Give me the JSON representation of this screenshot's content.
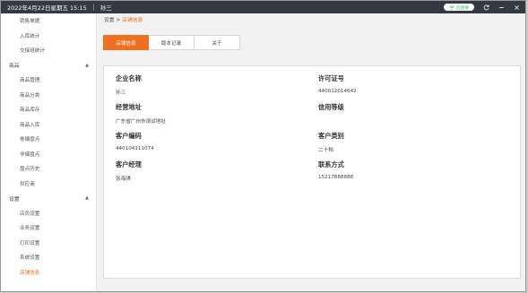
{
  "titlebar": {
    "datetime": "2022年4月22日星期五 15:15",
    "user": "孙三",
    "network_label": "已连接"
  },
  "sidebar": {
    "top_items": [
      {
        "label": "销售单据"
      },
      {
        "label": "入库统计"
      },
      {
        "label": "交接班统计"
      }
    ],
    "groups": [
      {
        "label": "商品",
        "items": [
          {
            "label": "商品管理"
          },
          {
            "label": "商品分类"
          },
          {
            "label": "商品库存"
          },
          {
            "label": "商品入库"
          },
          {
            "label": "卷烟盘点"
          },
          {
            "label": "非烟盘点"
          },
          {
            "label": "盘点历史"
          },
          {
            "label": "供应商"
          }
        ]
      },
      {
        "label": "设置",
        "items": [
          {
            "label": "店员设置"
          },
          {
            "label": "业务设置"
          },
          {
            "label": "打印设置"
          },
          {
            "label": "系统设置"
          },
          {
            "label": "店铺信息",
            "active": true
          }
        ]
      }
    ]
  },
  "breadcrumb": {
    "parent": "设置",
    "separator": ">",
    "current": "店铺信息"
  },
  "tabs": [
    {
      "label": "店铺信息",
      "active": true
    },
    {
      "label": "版本记录"
    },
    {
      "label": "关于"
    }
  ],
  "info": {
    "company_name": {
      "label": "企业名称",
      "value": "孙三"
    },
    "license_no": {
      "label": "许可证号",
      "value": "440012014642"
    },
    "address": {
      "label": "经营地址",
      "value": "广东省广州市测试地址"
    },
    "credit_level": {
      "label": "信用等级",
      "value": ""
    },
    "customer_code": {
      "label": "客户编码",
      "value": "440104111074"
    },
    "customer_type": {
      "label": "客户类别",
      "value": "二十档"
    },
    "manager": {
      "label": "客户经理",
      "value": "张海琪"
    },
    "contact": {
      "label": "联系方式",
      "value": "15217888888"
    }
  },
  "colors": {
    "accent": "#f0701f",
    "titlebar_bg": "#333a42",
    "network_green": "#3bb76a"
  }
}
